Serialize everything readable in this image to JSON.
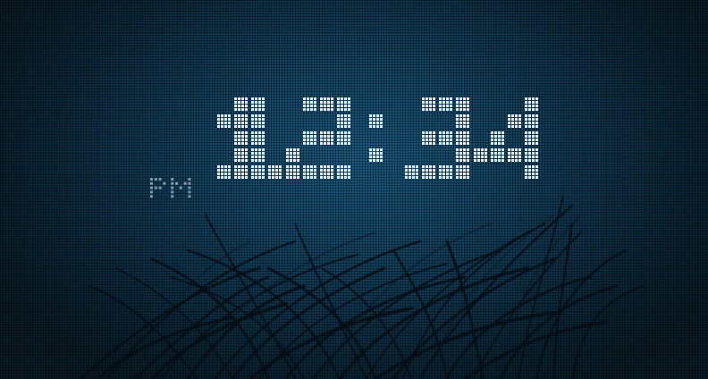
{
  "clock": {
    "time": "12:34",
    "period": "PM",
    "hours": "12",
    "minutes": "34"
  },
  "colors": {
    "digit": "#e4edf3",
    "period": "#7f97a6",
    "background_glow": "#1a5e86",
    "background_edge": "#091c28"
  }
}
